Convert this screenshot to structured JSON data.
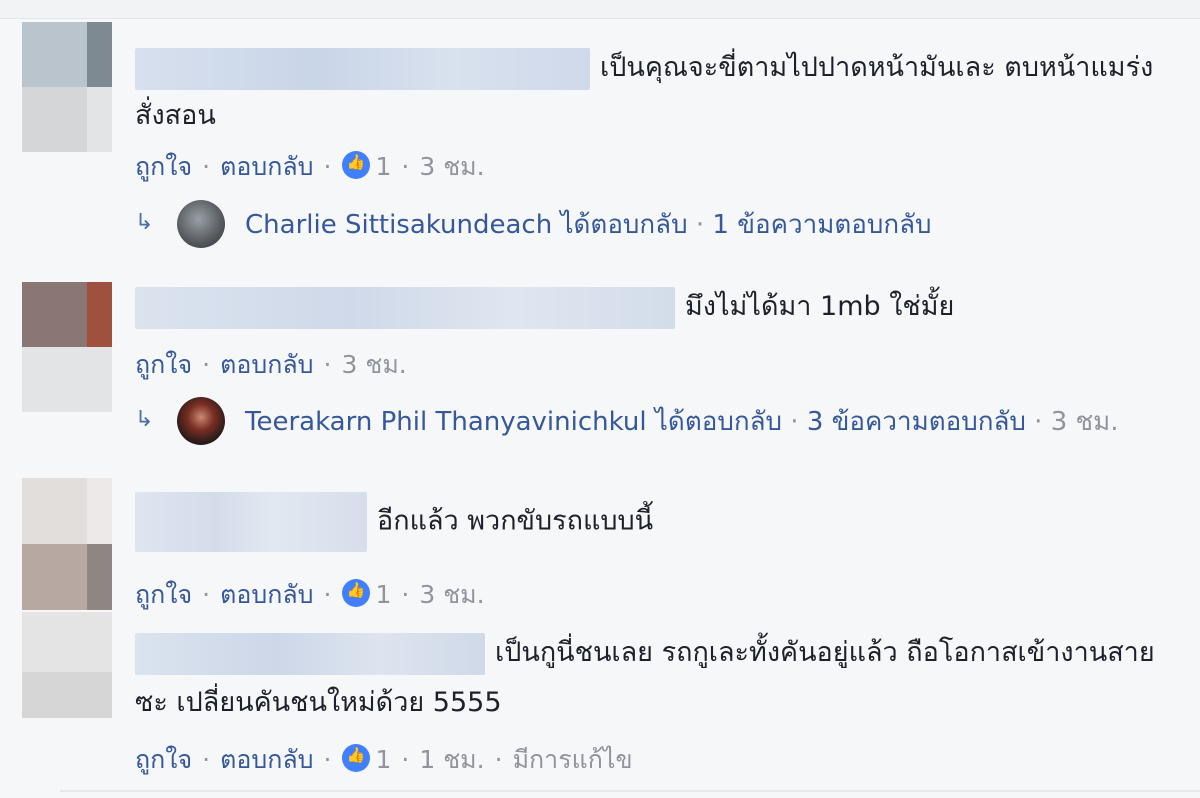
{
  "colors": {
    "link": "#365899",
    "meta": "#90949c",
    "text": "#1d2129",
    "like_badge": "#4080ff"
  },
  "comments": [
    {
      "text": "เป็นคุณจะขี่ตามไปปาดหน้ามันเละ ตบหน้าแมร่งสั่งสอน",
      "like_label": "ถูกใจ",
      "reply_label": "ตอบกลับ",
      "like_count": "1",
      "time": "3 ชม.",
      "reply": {
        "author": "Charlie Sittisakundeach",
        "action": "ได้ตอบกลับ",
        "summary": "1 ข้อความตอบกลับ"
      }
    },
    {
      "text": "มึงไม่ได้มา 1mb ใช่มั้ย",
      "like_label": "ถูกใจ",
      "reply_label": "ตอบกลับ",
      "time": "3 ชม.",
      "reply": {
        "author": "Teerakarn Phil Thanyavinichkul",
        "action": "ได้ตอบกลับ",
        "summary": "3 ข้อความตอบกลับ",
        "time": "3 ชม."
      }
    },
    {
      "text": "อีกแล้ว พวกขับรถแบบนี้",
      "like_label": "ถูกใจ",
      "reply_label": "ตอบกลับ",
      "like_count": "1",
      "time": "3 ชม."
    },
    {
      "text": "เป็นกูนี่ชนเลย รถกูเละทั้งคันอยู่แล้ว ถือโอกาสเข้างานสายซะ เปลี่ยนคันชนใหม่ด้วย 5555",
      "like_label": "ถูกใจ",
      "reply_label": "ตอบกลับ",
      "like_count": "1",
      "time": "1 ชม.",
      "edited": "มีการแก้ไข"
    }
  ]
}
